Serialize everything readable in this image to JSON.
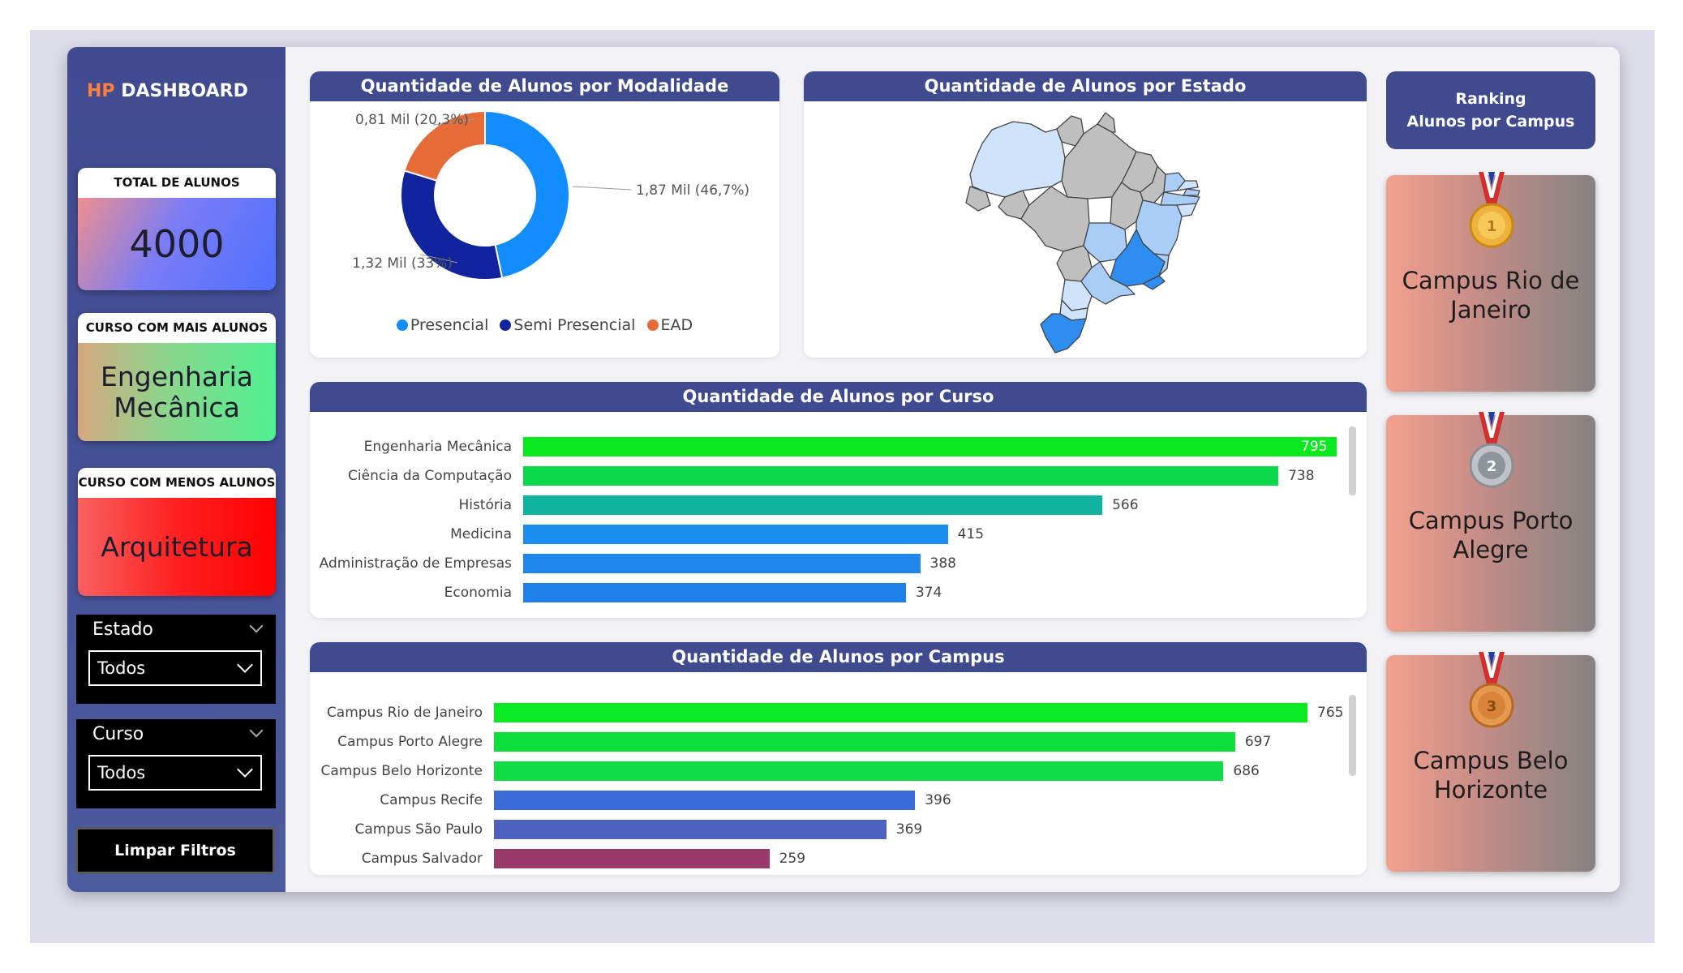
{
  "brand": {
    "prefix": "HP",
    "title": "DASHBOARD"
  },
  "kpis": {
    "total": {
      "label": "TOTAL DE ALUNOS",
      "value": "4000"
    },
    "most": {
      "label": "CURSO COM MAIS ALUNOS",
      "value": "Engenharia Mecânica"
    },
    "least": {
      "label": "CURSO COM MENOS ALUNOS",
      "value": "Arquitetura"
    }
  },
  "filters": {
    "estado": {
      "label": "Estado",
      "value": "Todos"
    },
    "curso": {
      "label": "Curso",
      "value": "Todos"
    },
    "clear_label": "Limpar Filtros"
  },
  "ranking": {
    "title_line1": "Ranking",
    "title_line2": "Alunos por Campus",
    "items": [
      {
        "place": "1",
        "name": "Campus Rio de Janeiro",
        "medal": "gold-medal-icon"
      },
      {
        "place": "2",
        "name": "Campus Porto Alegre",
        "medal": "silver-medal-icon"
      },
      {
        "place": "3",
        "name": "Campus Belo Horizonte",
        "medal": "bronze-medal-icon"
      }
    ]
  },
  "colors": {
    "header": "#3f4a8f",
    "brand_accent": "#ff7f3f",
    "presencial": "#118dff",
    "semi": "#12239e",
    "ead": "#e66c37"
  },
  "chart_data": [
    {
      "type": "pie",
      "title": "Quantidade de Alunos por Modalidade",
      "labels": [
        "Presencial",
        "Semi Presencial",
        "EAD"
      ],
      "values": [
        1870,
        1320,
        810
      ],
      "data_labels": [
        "1,87 Mil (46,7%)",
        "1,32 Mil (33%)",
        "0,81 Mil (20,3%)"
      ],
      "colors": [
        "#118dff",
        "#12239e",
        "#e66c37"
      ],
      "donut": true,
      "legend": "bottom"
    },
    {
      "type": "map",
      "title": "Quantidade de Alunos por Estado"
    },
    {
      "type": "bar",
      "orientation": "horizontal",
      "title": "Quantidade de Alunos por Curso",
      "categories": [
        "Engenharia Mecânica",
        "Ciência da Computação",
        "História",
        "Medicina",
        "Administração de Empresas",
        "Economia"
      ],
      "values": [
        795,
        738,
        566,
        415,
        388,
        374
      ],
      "colors": [
        "#0ae81f",
        "#0ad84a",
        "#0fb39e",
        "#1a8ff0",
        "#1f86ee",
        "#2080ea"
      ]
    },
    {
      "type": "bar",
      "orientation": "horizontal",
      "title": "Quantidade de Alunos por Campus",
      "categories": [
        "Campus Rio de Janeiro",
        "Campus Porto Alegre",
        "Campus Belo Horizonte",
        "Campus Recife",
        "Campus São Paulo",
        "Campus Salvador"
      ],
      "values": [
        765,
        697,
        686,
        396,
        369,
        259
      ],
      "colors": [
        "#0aea23",
        "#0ddf3c",
        "#10dc45",
        "#3a6bd8",
        "#4d62c0",
        "#9a3a6a"
      ]
    }
  ]
}
